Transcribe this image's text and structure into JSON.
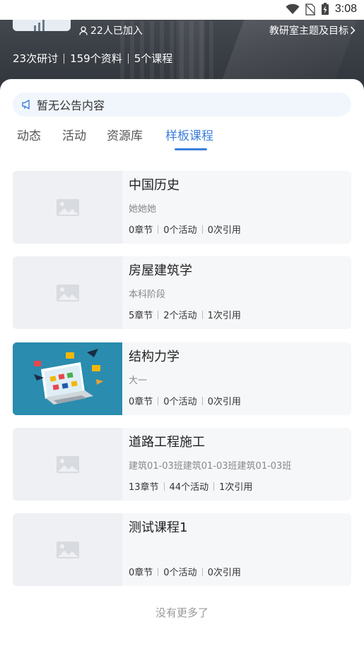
{
  "status_bar": {
    "time": "3:08"
  },
  "header": {
    "members": "22人已加入",
    "goal_link": "教研室主题及目标",
    "stats": [
      "23次研讨",
      "159个资料",
      "5个课程"
    ]
  },
  "notice": {
    "text": "暂无公告内容"
  },
  "tabs": [
    {
      "label": "动态",
      "active": false
    },
    {
      "label": "活动",
      "active": false
    },
    {
      "label": "资源库",
      "active": false
    },
    {
      "label": "样板课程",
      "active": true
    }
  ],
  "courses": [
    {
      "title": "中国历史",
      "subtitle": "她她她",
      "chapters": "0章节",
      "activities": "0个活动",
      "citations": "0次引用",
      "has_image": false
    },
    {
      "title": "房屋建筑学",
      "subtitle": "本科阶段",
      "chapters": "5章节",
      "activities": "2个活动",
      "citations": "1次引用",
      "has_image": false
    },
    {
      "title": "结构力学",
      "subtitle": "大一",
      "chapters": "0章节",
      "activities": "0个活动",
      "citations": "0次引用",
      "has_image": true
    },
    {
      "title": "道路工程施工",
      "subtitle": "建筑01-03班建筑01-03班建筑01-03班",
      "chapters": "13章节",
      "activities": "44个活动",
      "citations": "1次引用",
      "has_image": false
    },
    {
      "title": "测试课程1",
      "subtitle": "",
      "chapters": "0章节",
      "activities": "0个活动",
      "citations": "0次引用",
      "has_image": false
    }
  ],
  "footer": {
    "text": "没有更多了"
  },
  "colors": {
    "accent": "#3c7fdb",
    "notice_bg": "#f1f6fd",
    "card_bg": "#f6f7f9"
  }
}
